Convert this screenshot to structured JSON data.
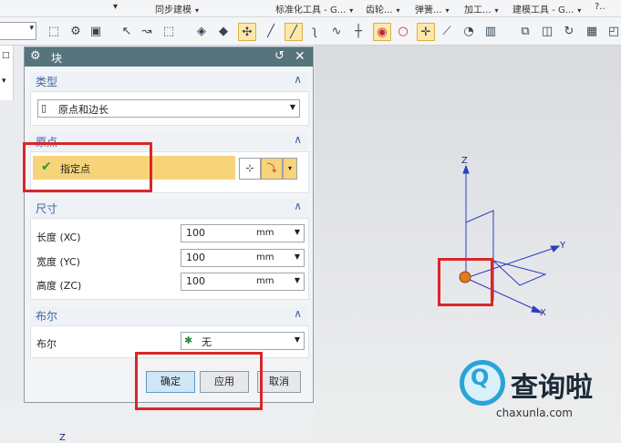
{
  "menu": {
    "sync": "同步建模",
    "std_tools": "标准化工具 - G...",
    "gear": "齿轮...",
    "spring": "弹簧...",
    "machining": "加工...",
    "modeling_tools": "建模工具 - G...",
    "more": "?.."
  },
  "dialog": {
    "title": "块",
    "type_section": "类型",
    "type_value": "原点和边长",
    "origin_section": "原点",
    "specify_point": "指定点",
    "dims_section": "尺寸",
    "length_label": "长度 (XC)",
    "width_label": "宽度 (YC)",
    "height_label": "高度 (ZC)",
    "length_value": "100",
    "width_value": "100",
    "height_value": "100",
    "unit": "mm",
    "bool_section": "布尔",
    "bool_label": "布尔",
    "bool_value": "无",
    "ok": "确定",
    "apply": "应用",
    "cancel": "取消"
  },
  "viewport": {
    "axis_z": "Z",
    "axis_y": "Y",
    "axis_x": "X",
    "bottom_label": "Z"
  },
  "watermark": {
    "name": "查询啦",
    "url": "chaxunla.com"
  },
  "colors": {
    "title_bar": "#55747c",
    "highlight": "#f7d37a",
    "red_box": "#d9262a",
    "axis_blue": "#2b3fbf"
  }
}
